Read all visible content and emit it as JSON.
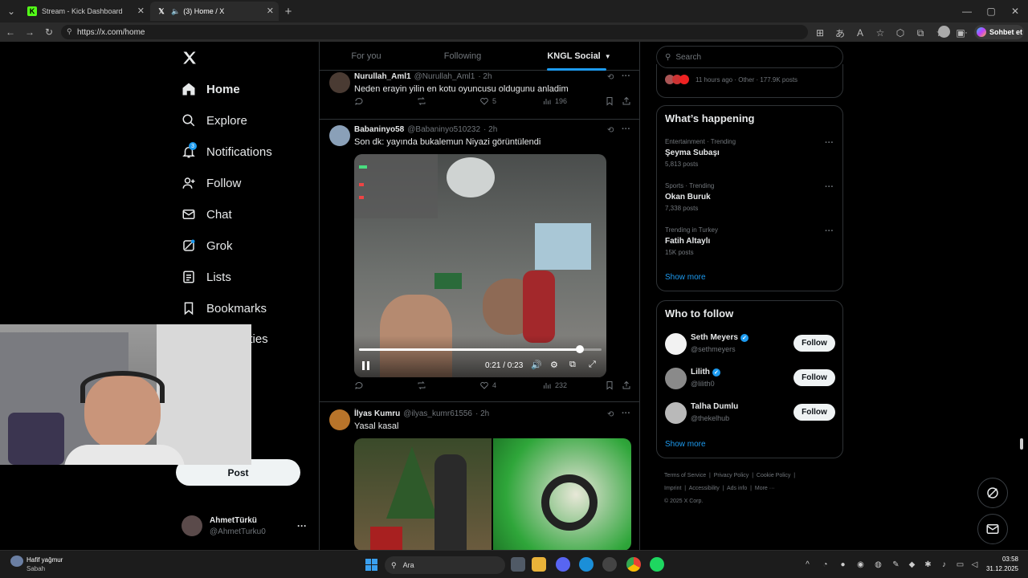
{
  "browser": {
    "tabs": [
      {
        "title": "Stream - Kick Dashboard",
        "icon": "kick-icon"
      },
      {
        "title": "(3) Home / X",
        "icon": "x-icon"
      }
    ],
    "url": "https://x.com/home",
    "copilot_label": "Sohbet et"
  },
  "nav": {
    "items": [
      {
        "label": "Home"
      },
      {
        "label": "Explore"
      },
      {
        "label": "Notifications",
        "badge": "3"
      },
      {
        "label": "Follow"
      },
      {
        "label": "Chat"
      },
      {
        "label": "Grok"
      },
      {
        "label": "Lists"
      },
      {
        "label": "Bookmarks"
      },
      {
        "label": "ities"
      }
    ],
    "post_label": "Post",
    "account": {
      "name": "AhmetTürkü",
      "handle": "@AhmetTurku0"
    }
  },
  "timeline": {
    "tabs": [
      "For you",
      "Following",
      "KNGL Social"
    ],
    "posts": [
      {
        "name": "Nurullah_Aml1",
        "handle": "@Nurullah_Aml1",
        "time": "· 2h",
        "text": "Neden erayin yilin en kotu oyuncusu oldugunu anladim",
        "likes": "5",
        "views": "196"
      },
      {
        "name": "Babaninyo58",
        "handle": "@Babaninyo510232",
        "time": "· 2h",
        "text": "Son dk: yayında bukalemun Niyazi görüntülendi",
        "likes": "4",
        "views": "232",
        "video": {
          "time": "0:21 / 0:23",
          "progress": 0.91
        }
      },
      {
        "name": "İlyas Kumru",
        "handle": "@ilyas_kumr61556",
        "time": "· 2h",
        "text": "Yasal kasal"
      }
    ]
  },
  "right": {
    "search_placeholder": "Search",
    "top_snippet": "11 hours ago · Other · 177.9K posts",
    "happening_title": "What’s happening",
    "trends": [
      {
        "meta": "Entertainment · Trending",
        "title": "Şeyma Subaşı",
        "count": "5,813 posts"
      },
      {
        "meta": "Sports · Trending",
        "title": "Okan Buruk",
        "count": "7,338 posts"
      },
      {
        "meta": "Trending in Turkey",
        "title": "Fatih Altaylı",
        "count": "15K posts"
      }
    ],
    "show_more": "Show more",
    "wtf_title": "Who to follow",
    "follow": [
      {
        "name": "Seth Meyers",
        "handle": "@sethmeyers",
        "verified": true
      },
      {
        "name": "Lilith",
        "handle": "@lilith0",
        "verified": true
      },
      {
        "name": "Talha Dumlu",
        "handle": "@thekelhub",
        "verified": false
      }
    ],
    "follow_label": "Follow",
    "footer_links": [
      "Terms of Service",
      "Privacy Policy",
      "Cookie Policy",
      "Imprint",
      "Accessibility",
      "Ads info",
      "More ···"
    ],
    "copyright": "© 2025 X Corp."
  },
  "taskbar": {
    "weather": "Hafif yağmur",
    "weather_sub": "Sabah",
    "search": "Ara",
    "time": "03:58",
    "date": "31.12.2025"
  },
  "colors": {
    "accent": "#1d9bf0",
    "bg": "#000000",
    "border": "#2f3336"
  }
}
